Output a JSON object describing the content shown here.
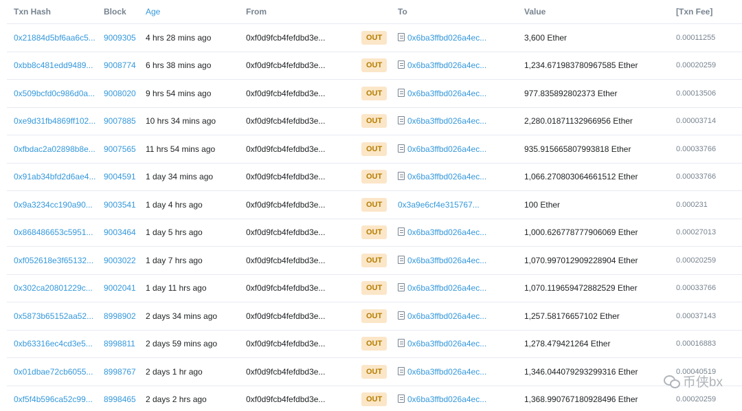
{
  "columns": {
    "txn_hash": "Txn Hash",
    "block": "Block",
    "age": "Age",
    "from": "From",
    "to": "To",
    "value": "Value",
    "txn_fee": "[Txn Fee]"
  },
  "rows": [
    {
      "hash": "0x21884d5bf6aa6c5...",
      "block": "9009305",
      "age": "4 hrs 28 mins ago",
      "from": "0xf0d9fcb4fefdbd3e...",
      "direction": "OUT",
      "to": "0x6ba3ffbd026a4ec...",
      "to_is_contract": true,
      "value": "3,600 Ether",
      "fee": "0.00011255"
    },
    {
      "hash": "0xbb8c481edd9489...",
      "block": "9008774",
      "age": "6 hrs 38 mins ago",
      "from": "0xf0d9fcb4fefdbd3e...",
      "direction": "OUT",
      "to": "0x6ba3ffbd026a4ec...",
      "to_is_contract": true,
      "value": "1,234.671983780967585 Ether",
      "fee": "0.00020259"
    },
    {
      "hash": "0x509bcfd0c986d0a...",
      "block": "9008020",
      "age": "9 hrs 54 mins ago",
      "from": "0xf0d9fcb4fefdbd3e...",
      "direction": "OUT",
      "to": "0x6ba3ffbd026a4ec...",
      "to_is_contract": true,
      "value": "977.835892802373 Ether",
      "fee": "0.00013506"
    },
    {
      "hash": "0xe9d31fb4869ff102...",
      "block": "9007885",
      "age": "10 hrs 34 mins ago",
      "from": "0xf0d9fcb4fefdbd3e...",
      "direction": "OUT",
      "to": "0x6ba3ffbd026a4ec...",
      "to_is_contract": true,
      "value": "2,280.01871132966956 Ether",
      "fee": "0.00003714"
    },
    {
      "hash": "0xfbdac2a02898b8e...",
      "block": "9007565",
      "age": "11 hrs 54 mins ago",
      "from": "0xf0d9fcb4fefdbd3e...",
      "direction": "OUT",
      "to": "0x6ba3ffbd026a4ec...",
      "to_is_contract": true,
      "value": "935.915665807993818 Ether",
      "fee": "0.00033766"
    },
    {
      "hash": "0x91ab34bfd2d6ae4...",
      "block": "9004591",
      "age": "1 day 34 mins ago",
      "from": "0xf0d9fcb4fefdbd3e...",
      "direction": "OUT",
      "to": "0x6ba3ffbd026a4ec...",
      "to_is_contract": true,
      "value": "1,066.270803064661512 Ether",
      "fee": "0.00033766"
    },
    {
      "hash": "0x9a3234cc190a90...",
      "block": "9003541",
      "age": "1 day 4 hrs ago",
      "from": "0xf0d9fcb4fefdbd3e...",
      "direction": "OUT",
      "to": "0x3a9e6cf4e315767...",
      "to_is_contract": false,
      "value": "100 Ether",
      "fee": "0.000231"
    },
    {
      "hash": "0x868486653c5951...",
      "block": "9003464",
      "age": "1 day 5 hrs ago",
      "from": "0xf0d9fcb4fefdbd3e...",
      "direction": "OUT",
      "to": "0x6ba3ffbd026a4ec...",
      "to_is_contract": true,
      "value": "1,000.626778777906069 Ether",
      "fee": "0.00027013"
    },
    {
      "hash": "0xf052618e3f65132...",
      "block": "9003022",
      "age": "1 day 7 hrs ago",
      "from": "0xf0d9fcb4fefdbd3e...",
      "direction": "OUT",
      "to": "0x6ba3ffbd026a4ec...",
      "to_is_contract": true,
      "value": "1,070.997012909228904 Ether",
      "fee": "0.00020259"
    },
    {
      "hash": "0x302ca20801229c...",
      "block": "9002041",
      "age": "1 day 11 hrs ago",
      "from": "0xf0d9fcb4fefdbd3e...",
      "direction": "OUT",
      "to": "0x6ba3ffbd026a4ec...",
      "to_is_contract": true,
      "value": "1,070.119659472882529 Ether",
      "fee": "0.00033766"
    },
    {
      "hash": "0x5873b65152aa52...",
      "block": "8998902",
      "age": "2 days 34 mins ago",
      "from": "0xf0d9fcb4fefdbd3e...",
      "direction": "OUT",
      "to": "0x6ba3ffbd026a4ec...",
      "to_is_contract": true,
      "value": "1,257.58176657102 Ether",
      "fee": "0.00037143"
    },
    {
      "hash": "0xb63316ec4cd3e5...",
      "block": "8998811",
      "age": "2 days 59 mins ago",
      "from": "0xf0d9fcb4fefdbd3e...",
      "direction": "OUT",
      "to": "0x6ba3ffbd026a4ec...",
      "to_is_contract": true,
      "value": "1,278.479421264 Ether",
      "fee": "0.00016883"
    },
    {
      "hash": "0x01dbae72cb6055...",
      "block": "8998767",
      "age": "2 days 1 hr ago",
      "from": "0xf0d9fcb4fefdbd3e...",
      "direction": "OUT",
      "to": "0x6ba3ffbd026a4ec...",
      "to_is_contract": true,
      "value": "1,346.044079293299316 Ether",
      "fee": "0.00040519"
    },
    {
      "hash": "0xf5f4b596ca52c99...",
      "block": "8998465",
      "age": "2 days 2 hrs ago",
      "from": "0xf0d9fcb4fefdbd3e...",
      "direction": "OUT",
      "to": "0x6ba3ffbd026a4ec...",
      "to_is_contract": true,
      "value": "1,368.990767180928496 Ether",
      "fee": "0.00020259"
    }
  ],
  "watermark": {
    "text": "币侠bx",
    "icon": "wechat-icon"
  },
  "colors": {
    "link": "#3498db",
    "out_badge_bg": "#fbe6c8",
    "out_badge_text": "#b47d00",
    "header_text": "#77838f"
  }
}
